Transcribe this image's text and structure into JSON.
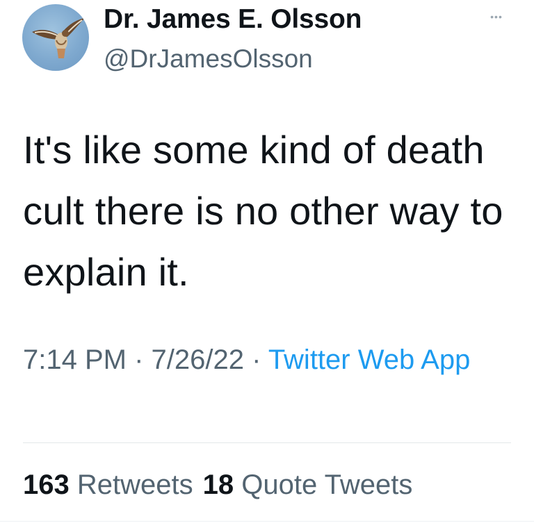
{
  "user": {
    "display_name": "Dr. James E. Olsson",
    "handle": "@DrJamesOlsson",
    "avatar_icon": "hawk-avatar"
  },
  "more_icon": "more-options-icon",
  "tweet": {
    "text": "It's like some kind of death cult there is no other way to explain it.",
    "time": "7:14 PM",
    "separator": " · ",
    "date": "7/26/22",
    "source": "Twitter Web App"
  },
  "stats": {
    "retweets_count": "163",
    "retweets_label": "Retweets",
    "quotes_count": "18",
    "quotes_label": "Quote Tweets"
  },
  "colors": {
    "link": "#1d9bf0",
    "secondary_text": "#536471",
    "primary_text": "#0f1419"
  }
}
